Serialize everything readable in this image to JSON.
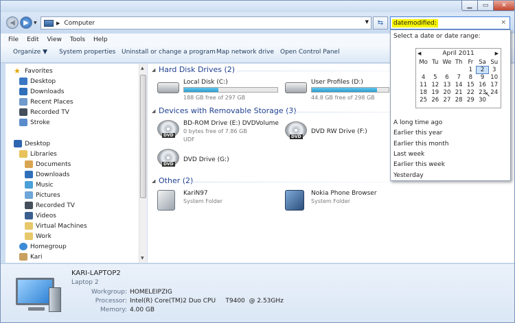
{
  "window": {
    "min_icon": "minimize-icon",
    "max_icon": "maximize-icon",
    "close_icon": "close-icon",
    "min_glyph": "▁",
    "max_glyph": "▭",
    "close_glyph": "✕"
  },
  "address": {
    "location": "Computer",
    "separator": "▶",
    "dropdown": "▼",
    "refresh": "⇆"
  },
  "search": {
    "value": "datemodified:",
    "clear": "×"
  },
  "menu": [
    "File",
    "Edit",
    "View",
    "Tools",
    "Help"
  ],
  "commands": {
    "organize": "Organize ▼",
    "system_properties": "System properties",
    "uninstall": "Uninstall or change a program",
    "map_drive": "Map network drive",
    "control_panel": "Open Control Panel"
  },
  "nav": {
    "favorites": "Favorites",
    "desktop_fav": "Desktop",
    "downloads_fav": "Downloads",
    "recent": "Recent Places",
    "recorded_tv_fav": "Recorded TV",
    "stroke": "Stroke",
    "desktop": "Desktop",
    "libraries": "Libraries",
    "documents": "Documents",
    "downloads": "Downloads",
    "music": "Music",
    "pictures": "Pictures",
    "recorded_tv": "Recorded TV",
    "videos": "Videos",
    "virtual_machines": "Virtual Machines",
    "work": "Work",
    "homegroup": "Homegroup",
    "kari": "Kari"
  },
  "groups": {
    "hdd": "Hard Disk Drives (2)",
    "removable": "Devices with Removable Storage (3)",
    "other": "Other (2)"
  },
  "drives": {
    "c": {
      "name": "Local Disk (C:)",
      "free": "188 GB free of 297 GB",
      "used_fraction": 0.37
    },
    "d": {
      "name": "User Profiles (D:)",
      "free": "44.8 GB free of 298 GB",
      "used_fraction": 0.85
    },
    "e": {
      "name": "BD-ROM Drive (E:) DVDVolume",
      "free": "0 bytes free of 7.86 GB",
      "fs": "UDF",
      "badge": "DVD"
    },
    "f": {
      "name": "DVD RW Drive (F:)",
      "badge": "DVD"
    },
    "g": {
      "name": "DVD Drive (G:)",
      "badge": "DVD"
    }
  },
  "other": {
    "kari": {
      "name": "KariN97",
      "type": "System Folder"
    },
    "nokia": {
      "name": "Nokia Phone Browser",
      "type": "System Folder"
    }
  },
  "date_picker": {
    "header": "Select a date or date range:",
    "month": "April 2011",
    "prev": "◀",
    "next": "▶",
    "dows": [
      "Mo",
      "Tu",
      "We",
      "Th",
      "Fr",
      "Sa",
      "Su"
    ],
    "weeks": [
      [
        "",
        "",
        "",
        "",
        "1",
        "2",
        "3"
      ],
      [
        "4",
        "5",
        "6",
        "7",
        "8",
        "9",
        "10"
      ],
      [
        "11",
        "12",
        "13",
        "14",
        "15",
        "16",
        "17"
      ],
      [
        "18",
        "19",
        "20",
        "21",
        "22",
        "23",
        "24"
      ],
      [
        "25",
        "26",
        "27",
        "28",
        "29",
        "30",
        ""
      ]
    ],
    "selected": "2",
    "options": [
      "A long time ago",
      "Earlier this year",
      "Earlier this month",
      "Last week",
      "Earlier this week",
      "Yesterday"
    ]
  },
  "details": {
    "computer_name": "KARI-LAPTOP2",
    "description": "Laptop 2",
    "workgroup_label": "Workgroup:",
    "workgroup": "HOMELEIPZIG",
    "processor_label": "Processor:",
    "processor": "Intel(R) Core(TM)2 Duo CPU     T9400  @ 2.53GHz",
    "memory_label": "Memory:",
    "memory": "4.00 GB"
  }
}
